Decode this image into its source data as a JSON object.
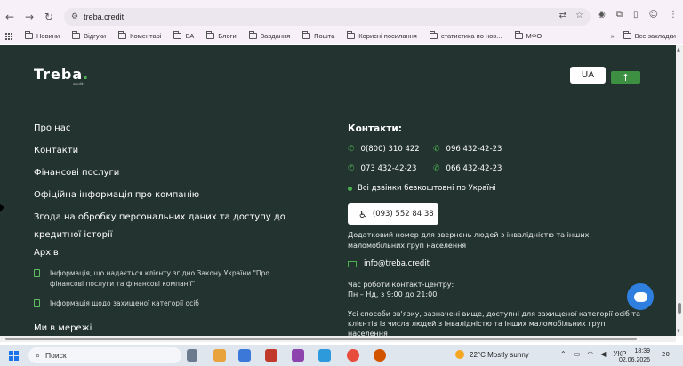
{
  "browser": {
    "url": "treba.credit",
    "bookmarks": [
      "Новини",
      "Відгуки",
      "Коментарі",
      "ВА",
      "Блоги",
      "Завдання",
      "Пошта",
      "Корисні посилання",
      "статистика по нов...",
      "МФО"
    ],
    "all_bookmarks": "Все закладки"
  },
  "site": {
    "logo": "Treba",
    "logo_sub": "credit",
    "lang": "UA",
    "menu": [
      "Про нас",
      "Контакти",
      "Фінансові послуги",
      "Офіційна інформація про компанію",
      "Згода на обробку персональних даних та доступу до",
      "кредитної історії",
      "Архів"
    ],
    "docs": [
      [
        "Інформація, що надається клієнту згідно Закону України \"Про",
        "фінансові послуги та фінансові компанії\""
      ],
      [
        "Інформація щодо захищеної категорії осіб"
      ]
    ],
    "social_title": "Ми в мережі",
    "contacts": {
      "title": "Контакти:",
      "phones": [
        "0(800) 310 422",
        "096 432-42-23",
        "073 432-42-23",
        "066 432-42-23"
      ],
      "free_calls": "Всі дзвінки безкоштовні по Україні",
      "accessible_phone": "(093) 552 84 38",
      "accessible_note": "Додатковий номер для звернень людей з інвалідністю та інших маломобільних груп населення",
      "email": "info@treba.credit",
      "hours_title": "Час роботи контакт-центру:",
      "hours": "Пн – Нд, з 9:00 до 21:00",
      "disclaimer": "Усі способи зв'язку, зазначені вище, доступні для захищеної категорії осіб та клієнтів із числа людей з інвалідністю та інших маломобільних груп населення"
    }
  },
  "taskbar": {
    "search": "Поиск",
    "weather": "22°C  Mostly sunny",
    "lang": "УКР",
    "time": "18:39",
    "date": "02.06.2026",
    "notifications": "20"
  }
}
